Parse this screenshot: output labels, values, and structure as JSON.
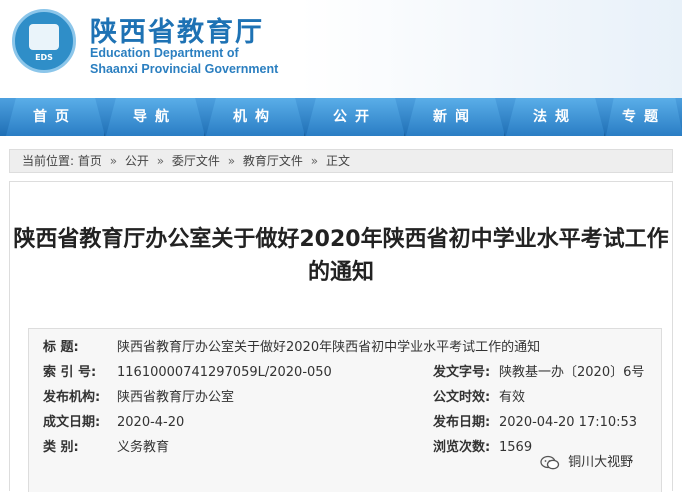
{
  "header": {
    "title_cn": "陕西省教育厅",
    "title_en_line1": "Education Department of",
    "title_en_line2": "Shaanxi Provincial Government",
    "logo_text": "EDS"
  },
  "nav": {
    "items": [
      {
        "label": "首页"
      },
      {
        "label": "导航"
      },
      {
        "label": "机构"
      },
      {
        "label": "公开"
      },
      {
        "label": "新闻"
      },
      {
        "label": "法规"
      },
      {
        "label": "专题"
      }
    ]
  },
  "breadcrumb": {
    "prefix": "当前位置:",
    "items": [
      "首页",
      "公开",
      "委厅文件",
      "教育厅文件",
      "正文"
    ],
    "separator": "»"
  },
  "article": {
    "title_line1": "陕西省教育厅办公室关于做好2020年陕西省初中学业水平考试工作",
    "title_line2": "的通知"
  },
  "meta": {
    "title_key": "标 题:",
    "title_val": "陕西省教育厅办公室关于做好2020年陕西省初中学业水平考试工作的通知",
    "index_key": "索 引 号:",
    "index_val": "11610000741297059L/2020-050",
    "docno_key": "发文字号:",
    "docno_val": "陕教基一办〔2020〕6号",
    "issuer_key": "发布机构:",
    "issuer_val": "陕西省教育厅办公室",
    "validity_key": "公文时效:",
    "validity_val": "有效",
    "date_key": "成文日期:",
    "date_val": "2020-4-20",
    "pubtime_key": "发布日期:",
    "pubtime_val": "2020-04-20 17:10:53",
    "category_key": "类 别:",
    "category_val": "义务教育",
    "views_key": "浏览次数:",
    "views_val": "1569"
  },
  "watermark": {
    "text": "铜川大视野"
  }
}
